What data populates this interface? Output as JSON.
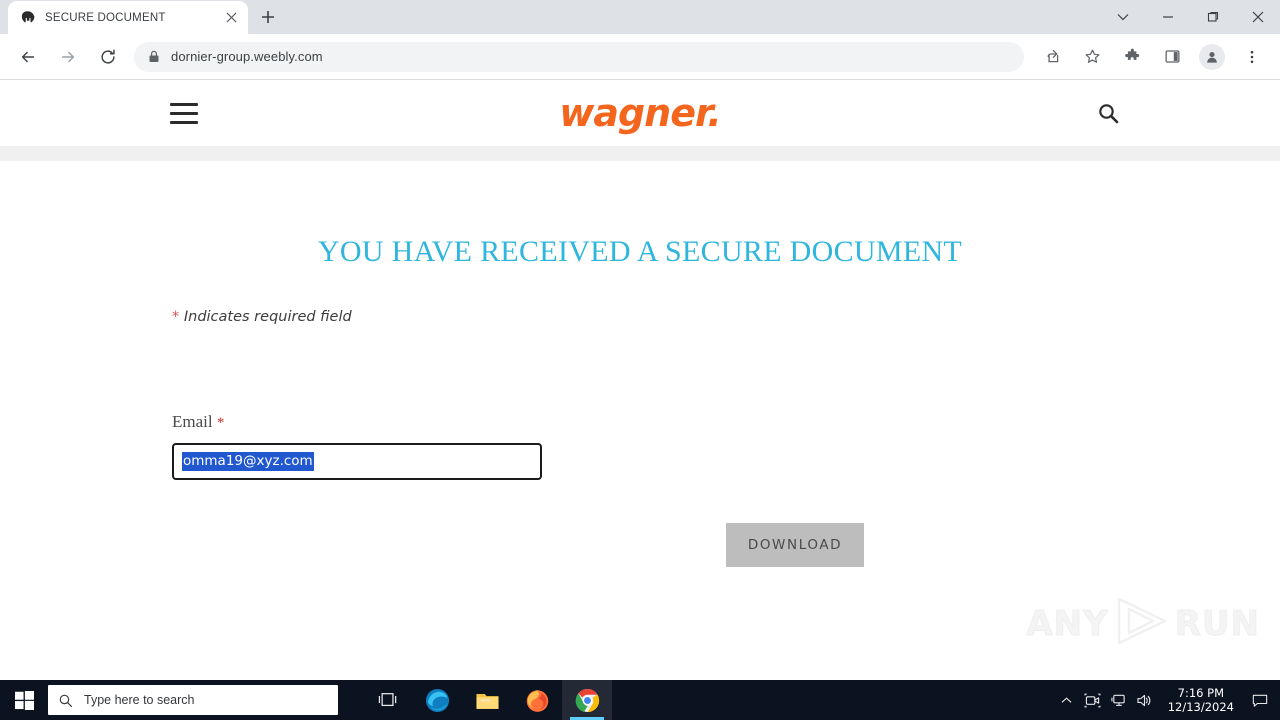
{
  "browser": {
    "tab": {
      "title": "SECURE DOCUMENT",
      "favicon_name": "weebly-w-icon",
      "close_label": "×"
    },
    "new_tab_label": "+",
    "window_controls": {
      "tab_search_label": "⌄",
      "minimize_label": "—",
      "maximize_label": "❐",
      "close_label": "✕"
    },
    "toolbar": {
      "back_label": "←",
      "forward_label": "→",
      "reload_label": "⟳",
      "url": "dornier-group.weebly.com",
      "url_placeholder": "Search Google or type a URL",
      "lock_name": "lock-icon",
      "share_name": "share-icon",
      "bookmark_name": "star-icon",
      "extensions_name": "puzzle-icon",
      "side_panel_name": "side-panel-icon",
      "profile_name": "profile-avatar-icon",
      "menu_label": "⋮"
    }
  },
  "site": {
    "logo_text": "wagner.",
    "logo_color": "#f4661e",
    "menu_name": "hamburger-menu-icon",
    "search_name": "search-icon"
  },
  "main": {
    "headline": "YOU HAVE RECEIVED A SECURE DOCUMENT",
    "headline_color": "#2eb6dd",
    "required_note_star": "*",
    "required_note_text": " Indicates required field",
    "email_label": "Email",
    "email_required_star": "*",
    "email_value": "omma19@xyz.com",
    "email_placeholder": "",
    "download_label": "DOWNLOAD",
    "watermark_left": "ANY",
    "watermark_right": "RUN"
  },
  "taskbar": {
    "start_name": "windows-start-icon",
    "search_placeholder": "Type here to search",
    "task_view_name": "task-view-icon",
    "apps": [
      {
        "name": "edge-icon",
        "active": false
      },
      {
        "name": "file-explorer-icon",
        "active": false
      },
      {
        "name": "firefox-icon",
        "active": false
      },
      {
        "name": "chrome-icon",
        "active": true
      }
    ],
    "tray": {
      "chevron_label": "∧",
      "camera_name": "camera-icon",
      "network_name": "network-icon",
      "volume_name": "volume-icon"
    },
    "time": "7:16 PM",
    "date": "12/13/2024",
    "notifications_name": "action-center-icon"
  }
}
